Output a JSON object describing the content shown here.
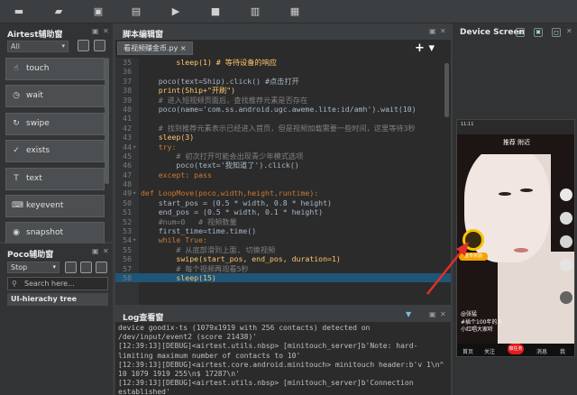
{
  "toolbar": {
    "buttons": [
      {
        "name": "new-file-button",
        "icon": "new-file-icon",
        "glyph": "▬"
      },
      {
        "name": "open-folder-button",
        "icon": "folder-icon",
        "glyph": "▰"
      },
      {
        "name": "save-button",
        "icon": "save-icon",
        "glyph": "▣"
      },
      {
        "name": "save-as-button",
        "icon": "save-as-icon",
        "glyph": "▤"
      },
      {
        "name": "run-button",
        "icon": "play-icon",
        "glyph": "▶"
      },
      {
        "name": "stop-button",
        "icon": "stop-icon",
        "glyph": "■"
      },
      {
        "name": "record-button",
        "icon": "record-icon",
        "glyph": "▥"
      },
      {
        "name": "settings-button",
        "icon": "settings-icon",
        "glyph": "▦"
      }
    ]
  },
  "airtest_panel": {
    "title": "Airtest辅助窗",
    "filter": "All",
    "items": [
      {
        "label": "touch",
        "icon": "touch-icon",
        "glyph": "☝"
      },
      {
        "label": "wait",
        "icon": "clock-icon",
        "glyph": "◷"
      },
      {
        "label": "swipe",
        "icon": "swipe-icon",
        "glyph": "↻"
      },
      {
        "label": "exists",
        "icon": "check-icon",
        "glyph": "✓"
      },
      {
        "label": "text",
        "icon": "text-icon",
        "glyph": "T"
      },
      {
        "label": "keyevent",
        "icon": "keyboard-icon",
        "glyph": "⌨"
      },
      {
        "label": "snapshot",
        "icon": "camera-icon",
        "glyph": "◉"
      }
    ]
  },
  "poco_panel": {
    "title": "Poco辅助窗",
    "mode": "Stop",
    "search_placeholder": "Search here...",
    "tree_label": "UI-hierachy tree"
  },
  "editor": {
    "title": "脚本编辑窗",
    "tab_label": "看视频赚金币.py",
    "tab_close": "×",
    "lines": [
      {
        "n": "35",
        "fold": "",
        "text": "        sleep(1) # 等待设备的响应",
        "hl": false
      },
      {
        "n": "36",
        "fold": "",
        "text": "",
        "hl": false
      },
      {
        "n": "37",
        "fold": "",
        "text": "    poco(text=Ship).click() #点击打开",
        "hl": false
      },
      {
        "n": "38",
        "fold": "",
        "text": "    print(Ship+\"开刷\")",
        "hl": false
      },
      {
        "n": "39",
        "fold": "",
        "text": "    # 进入短视频页面后，查找推荐元素是否存在",
        "hl": false
      },
      {
        "n": "40",
        "fold": "",
        "text": "    poco(name='com.ss.android.ugc.aweme.lite:id/amh').wait(10)",
        "hl": false
      },
      {
        "n": "41",
        "fold": "",
        "text": "",
        "hl": false
      },
      {
        "n": "42",
        "fold": "",
        "text": "    # 找到推荐元素表示已经进入首页，但是视频加载需要一些时间，这里等待3秒",
        "hl": false
      },
      {
        "n": "43",
        "fold": "",
        "text": "    sleep(3)",
        "hl": false
      },
      {
        "n": "44",
        "fold": "▾",
        "text": "    try:",
        "hl": false
      },
      {
        "n": "45",
        "fold": "",
        "text": "        # 初次打开可能会出现青少年模式选项",
        "hl": false
      },
      {
        "n": "46",
        "fold": "",
        "text": "        poco(text='我知道了').click()",
        "hl": false
      },
      {
        "n": "47",
        "fold": "",
        "text": "    except: pass",
        "hl": false
      },
      {
        "n": "48",
        "fold": "",
        "text": "",
        "hl": false
      },
      {
        "n": "49",
        "fold": "▾",
        "text": "def LoopMove(poco,width,height,runtime):",
        "hl": false
      },
      {
        "n": "50",
        "fold": "",
        "text": "    start_pos = (0.5 * width, 0.8 * height)",
        "hl": false
      },
      {
        "n": "51",
        "fold": "",
        "text": "    end_pos = (0.5 * width, 0.1 * height)",
        "hl": false
      },
      {
        "n": "52",
        "fold": "",
        "text": "    #num=0   # 视频数量",
        "hl": false
      },
      {
        "n": "53",
        "fold": "",
        "text": "    first_time=time.time()",
        "hl": false
      },
      {
        "n": "54",
        "fold": "▾",
        "text": "    while True:",
        "hl": false
      },
      {
        "n": "55",
        "fold": "",
        "text": "        # 从底部滑到上面, 切换视频",
        "hl": false
      },
      {
        "n": "56",
        "fold": "",
        "text": "        swipe(start_pos, end_pos, duration=1)",
        "hl": false
      },
      {
        "n": "57",
        "fold": "",
        "text": "        # 每个视频再观看5秒",
        "hl": false
      },
      {
        "n": "58",
        "fold": "",
        "text": "        sleep(15)",
        "hl": true
      }
    ]
  },
  "log_panel": {
    "title": "Log查看窗",
    "lines": [
      "device goodix-ts (1079x1919 with 256 contacts) detected on",
      "/dev/input/event2 (score 21438)'",
      "[12:39:13][DEBUG]<airtest.utils.nbsp> [minitouch_server]b'Note: hard-",
      "limiting maximum number of contacts to 10'",
      "[12:39:13][DEBUG]<airtest.core.android.minitouch> minitouch header:b'v 1\\n^",
      "10 1079 1919 255\\n$ 17287\\n'",
      "[12:39:13][DEBUG]<airtest.utils.nbsp> [minitouch_server]b'Connection",
      "established'"
    ]
  },
  "device_panel": {
    "title": "Device Screen",
    "phone": {
      "status_time": "11:11",
      "tabs": "推荐   附近",
      "coin_label": "金币奖励",
      "username": "@张猛",
      "caption": "#插个100年的人",
      "caption2": "小红唱大家听",
      "bottom_tabs": [
        "首页",
        "关注",
        "消息",
        "我"
      ],
      "red_button": "做任务"
    }
  },
  "colors": {
    "accent": "#1f5577",
    "background": "#3c3f41",
    "editor_bg": "#2b2b2b",
    "arrow": "#e0302a"
  }
}
